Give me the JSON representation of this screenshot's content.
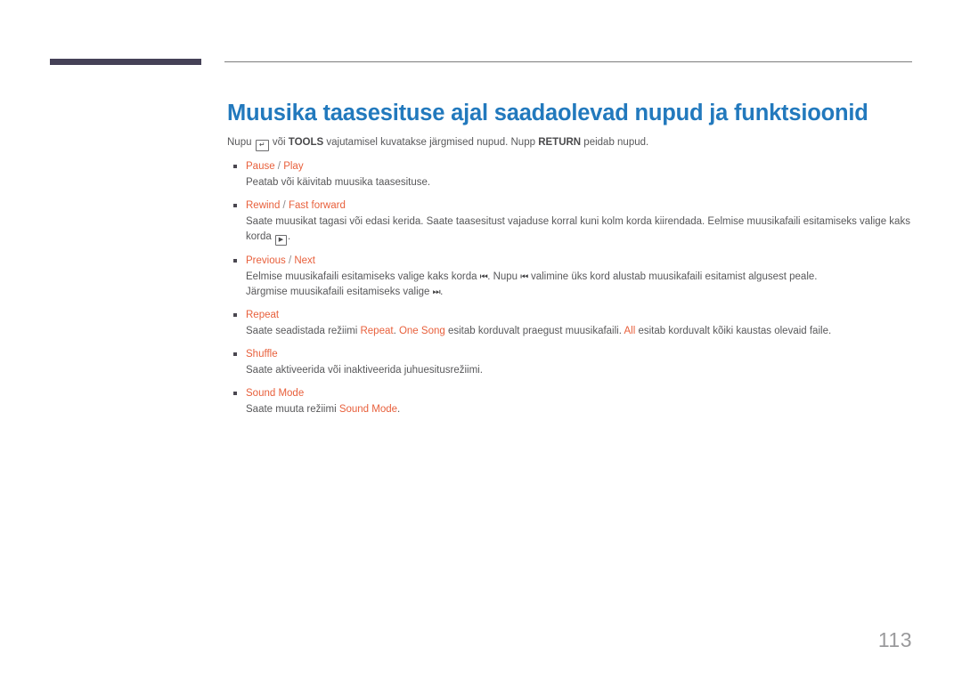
{
  "header": {
    "deco_bar_color": "#454157",
    "rule_color": "#7c7c7c"
  },
  "title": "Muusika taasesituse ajal saadaolevad nupud ja funktsioonid",
  "title_color": "#2279bd",
  "accent_color": "#e8603c",
  "body_color": "#58585a",
  "intro": {
    "part1": "Nupu ",
    "enter_icon": "↵",
    "part2": " või ",
    "tools_label": "TOOLS",
    "part3": " vajutamisel kuvatakse järgmised nupud. Nupp ",
    "return_label": "RETURN",
    "part4": " peidab nupud."
  },
  "bullets": [
    {
      "title_main": "Pause",
      "title_sep": " / ",
      "title_alt": "Play",
      "desc": "Peatab või käivitab muusika taasesituse."
    },
    {
      "title_main": "Rewind",
      "title_sep": " / ",
      "title_alt": "Fast forward",
      "desc_part1": "Saate muusikat tagasi või edasi kerida. Saate taasesitust vajaduse korral kuni kolm korda kiirendada. Eelmise muusikafaili esitamiseks valige kaks korda ",
      "play_icon": "▶",
      "desc_part2": "."
    },
    {
      "title_main": "Previous",
      "title_sep": " / ",
      "title_alt": "Next",
      "desc_part1": "Eelmise muusikafaili esitamiseks valige kaks korda ",
      "prev_icon": "⏮",
      "desc_part2": ". Nupu ",
      "prev_icon2": "⏮",
      "desc_part3": " valimine üks kord alustab muusikafaili esitamist algusest peale.",
      "desc_line2_part1": "Järgmise muusikafaili esitamiseks valige ",
      "next_icon": "⏭",
      "desc_line2_part2": "."
    },
    {
      "title_main": "Repeat",
      "desc_part1": "Saate seadistada režiimi ",
      "hl1": "Repeat",
      "desc_part2": ". ",
      "hl2": "One Song",
      "desc_part3": " esitab korduvalt praegust muusikafaili. ",
      "hl3": "All",
      "desc_part4": " esitab korduvalt kõiki kaustas olevaid faile."
    },
    {
      "title_main": "Shuffle",
      "desc": "Saate aktiveerida või inaktiveerida juhuesitusrežiimi."
    },
    {
      "title_main": "Sound Mode",
      "desc_part1": "Saate muuta režiimi ",
      "hl1": "Sound Mode",
      "desc_part2": "."
    }
  ],
  "page_number": "113"
}
